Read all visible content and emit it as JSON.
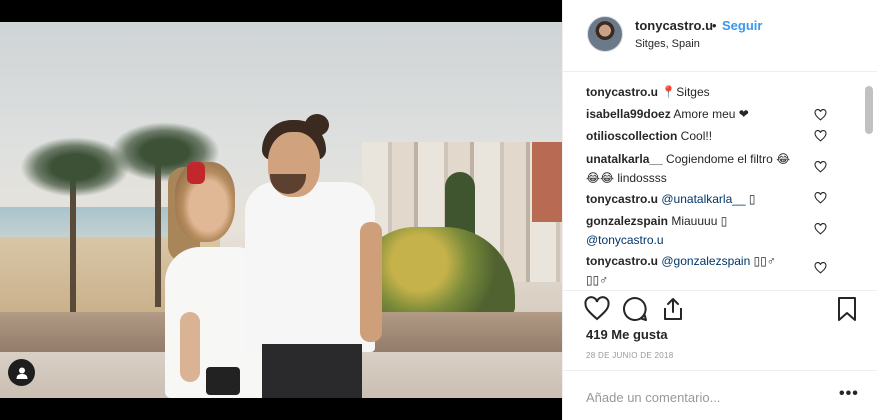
{
  "post": {
    "user_tag_icon": "user-tag-icon"
  },
  "header": {
    "username": "tonycastro.u",
    "separator": "•",
    "follow_label": "Seguir",
    "location": "Sitges, Spain"
  },
  "comments": [
    {
      "user": "tonycastro.u",
      "text": " 📍Sitges",
      "liked_icon": false
    },
    {
      "user": "isabella99doez",
      "text": " Amore meu ❤",
      "liked_icon": true
    },
    {
      "user": "otilioscollection",
      "text": " Cool!!",
      "liked_icon": true
    },
    {
      "user": "unatalkarla__",
      "text": " Cogiendome el filtro 😂",
      "text2": "😂😂 lindossss",
      "liked_icon": true
    },
    {
      "user": "tonycastro.u",
      "mention": "@unatalkarla__",
      "text": " ▯",
      "liked_icon": true
    },
    {
      "user": "gonzalezspain",
      "text": " Miauuuu ▯",
      "mention2": "@tonycastro.u",
      "liked_icon": true
    },
    {
      "user": "tonycastro.u",
      "mention": "@gonzalezspain",
      "text": " ▯▯♂",
      "text2": "▯▯♂",
      "liked_icon": true
    }
  ],
  "actions": {
    "like_icon": "heart-icon",
    "comment_icon": "comment-icon",
    "share_icon": "share-icon",
    "save_icon": "bookmark-icon"
  },
  "likes": "419 Me gusta",
  "date": "28 DE JUNIO DE 2018",
  "add_comment": {
    "placeholder": "Añade un comentario...",
    "more_label": "•••"
  }
}
